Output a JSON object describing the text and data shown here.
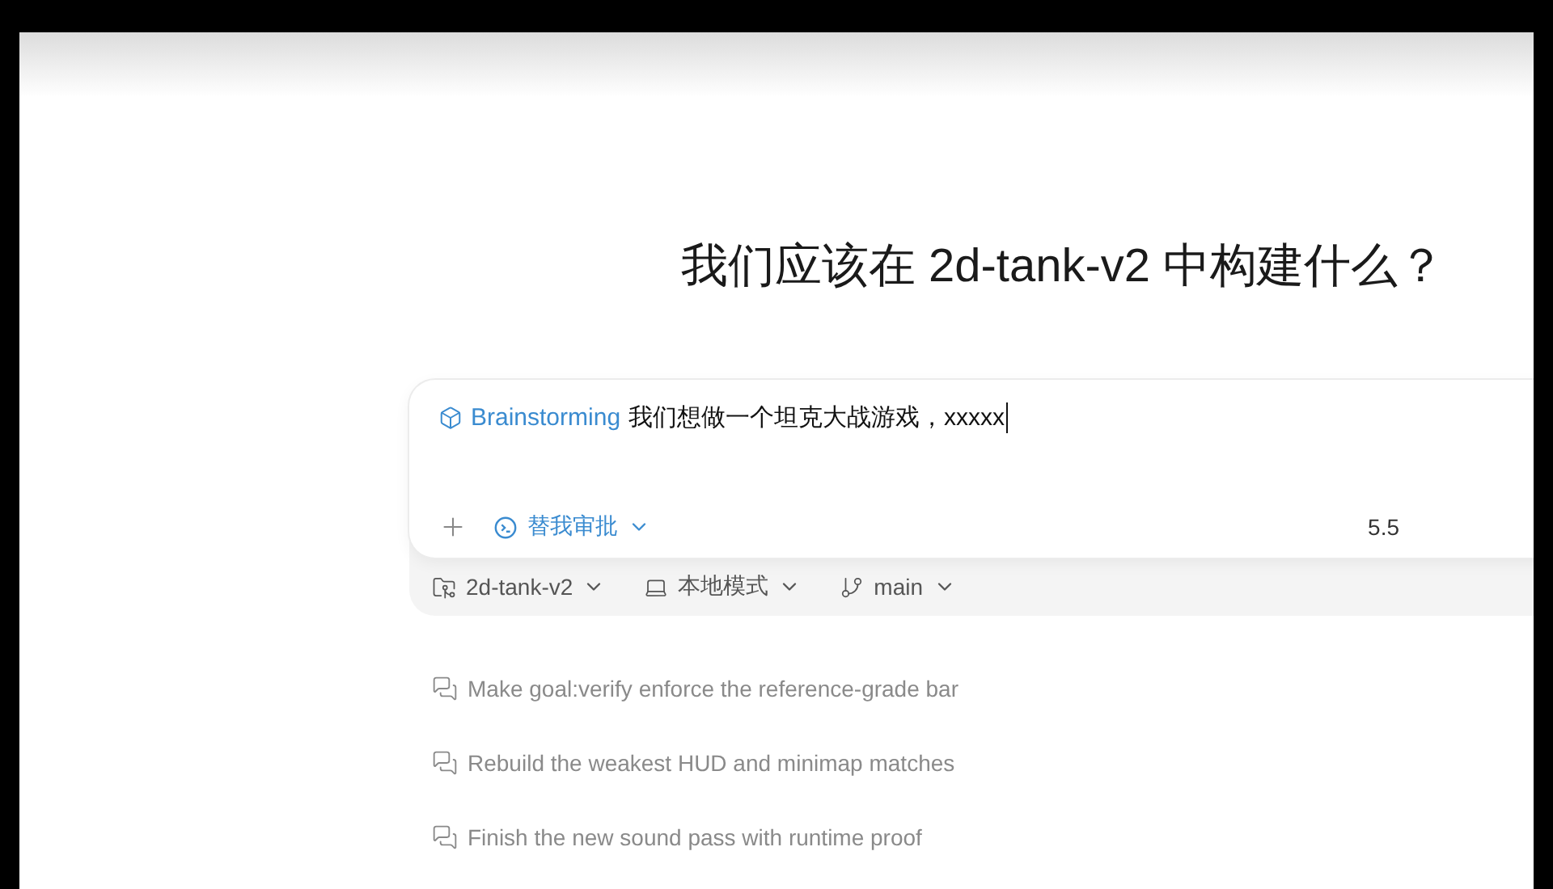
{
  "title": "我们应该在 2d-tank-v2 中构建什么？",
  "composer": {
    "mode_tag": "Brainstorming",
    "value": "我们想做一个坦克大战游戏，xxxxx",
    "approval": "替我审批",
    "model": "5.5"
  },
  "context_bar": [
    {
      "kind": "project",
      "label": "2d-tank-v2"
    },
    {
      "kind": "environment",
      "label": "本地模式"
    },
    {
      "kind": "branch",
      "label": "main"
    }
  ],
  "suggestions": [
    "Make goal:verify enforce the reference-grade bar",
    "Rebuild the weakest HUD and minimap matches",
    "Finish the new sound pass with runtime proof"
  ]
}
